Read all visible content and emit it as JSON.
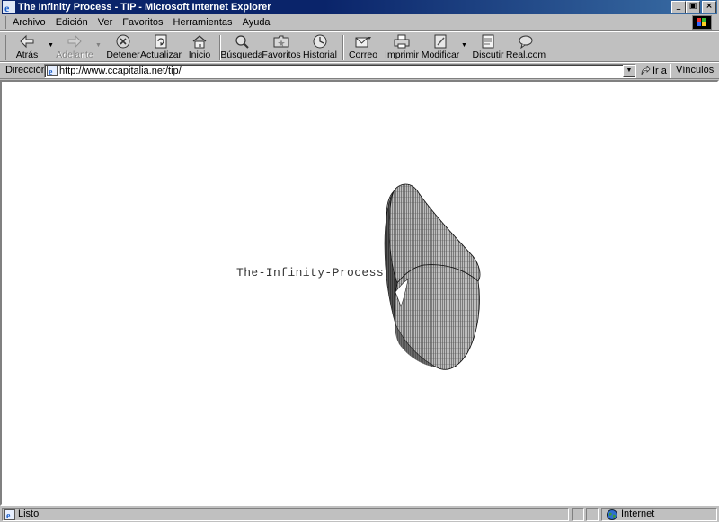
{
  "window": {
    "title": "The Infinity Process - TIP - Microsoft Internet Explorer",
    "controls": {
      "minimize": "_",
      "maximize": "▣",
      "close": "×"
    }
  },
  "menu": [
    "Archivo",
    "Edición",
    "Ver",
    "Favoritos",
    "Herramientas",
    "Ayuda"
  ],
  "toolbar": {
    "back": "Atrás",
    "forward": "Adelante",
    "stop": "Detener",
    "refresh": "Actualizar",
    "home": "Inicio",
    "search": "Búsqueda",
    "favorites": "Favoritos",
    "history": "Historial",
    "mail": "Correo",
    "print": "Imprimir",
    "edit": "Modificar",
    "discuss": "Discutir",
    "realcom": "Real.com"
  },
  "address": {
    "label": "Dirección",
    "url": "http://www.ccapitalia.net/tip/",
    "go": "Ir a",
    "links": "Vínculos"
  },
  "page": {
    "heading": "The-Infinity-Process"
  },
  "status": {
    "text": "Listo",
    "zone": "Internet"
  },
  "colors": {
    "titlebar": "#0a246a",
    "chrome": "#c0c0c0",
    "content_bg": "#ffffff"
  }
}
